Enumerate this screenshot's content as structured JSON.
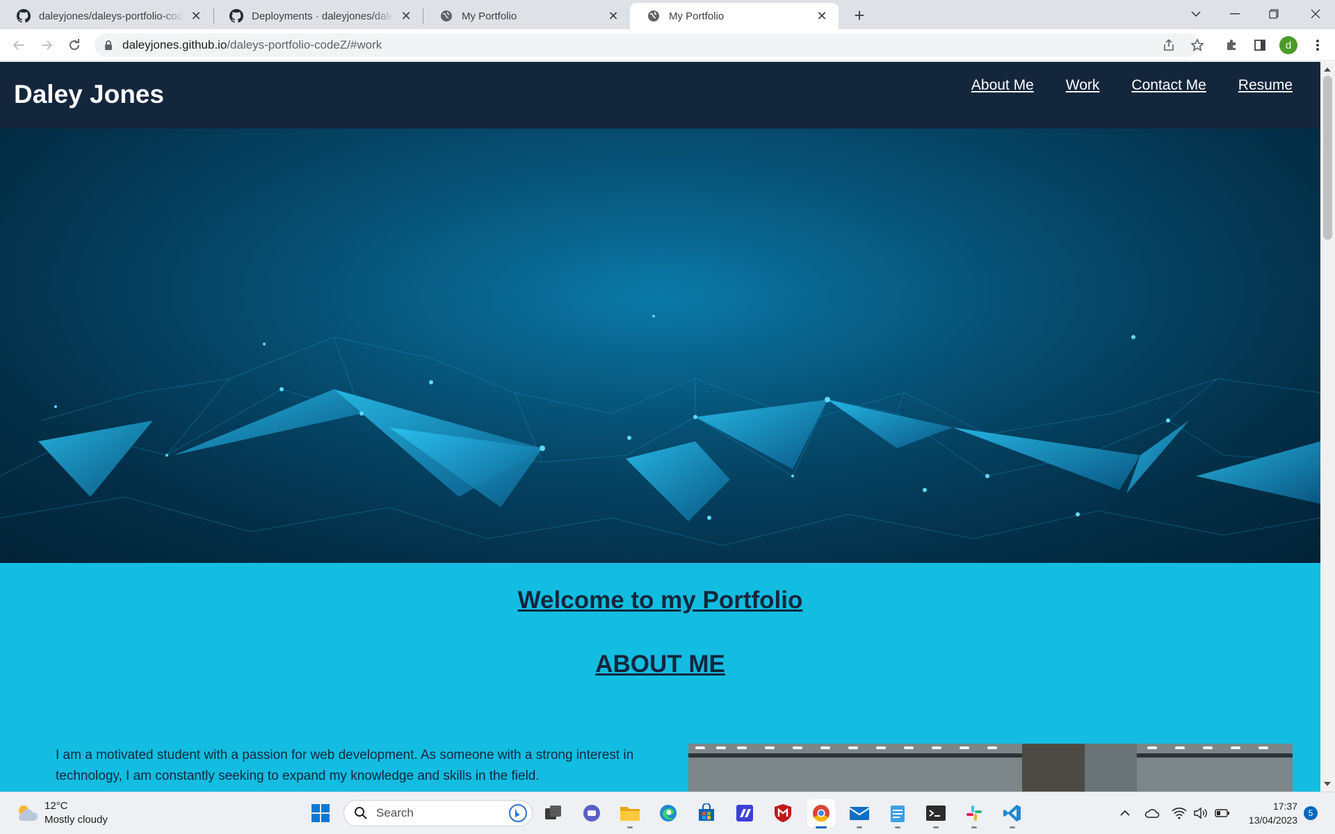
{
  "browser": {
    "tabs": [
      {
        "title": "daleyjones/daleys-portfolio-codeZ",
        "favicon": "github-icon"
      },
      {
        "title": "Deployments · daleyjones/daleys-portfolio-codeZ",
        "favicon": "github-icon"
      },
      {
        "title": "My Portfolio",
        "favicon": "globe-icon"
      },
      {
        "title": "My Portfolio",
        "favicon": "globe-icon",
        "active": true
      }
    ],
    "url_host": "daleyjones.github.io",
    "url_path": "/daleys-portfolio-codeZ/#work",
    "profile_initial": "d"
  },
  "site": {
    "name": "Daley Jones",
    "nav": [
      "About Me",
      "Work",
      "Contact Me",
      "Resume"
    ],
    "welcome": "Welcome to my Portfolio",
    "about_title": "ABOUT ME",
    "about_text": "I am a motivated student with a passion for web development. As someone with a strong interest in technology, I am constantly seeking to expand my knowledge and skills in the field.",
    "colors": {
      "header": "#14263c",
      "content_bg": "#13bde1",
      "hero": "#064b6e"
    }
  },
  "taskbar": {
    "weather_temp": "12°C",
    "weather_desc": "Mostly cloudy",
    "search_placeholder": "Search",
    "time": "17:37",
    "date": "13/04/2023",
    "notification_count": "5"
  }
}
